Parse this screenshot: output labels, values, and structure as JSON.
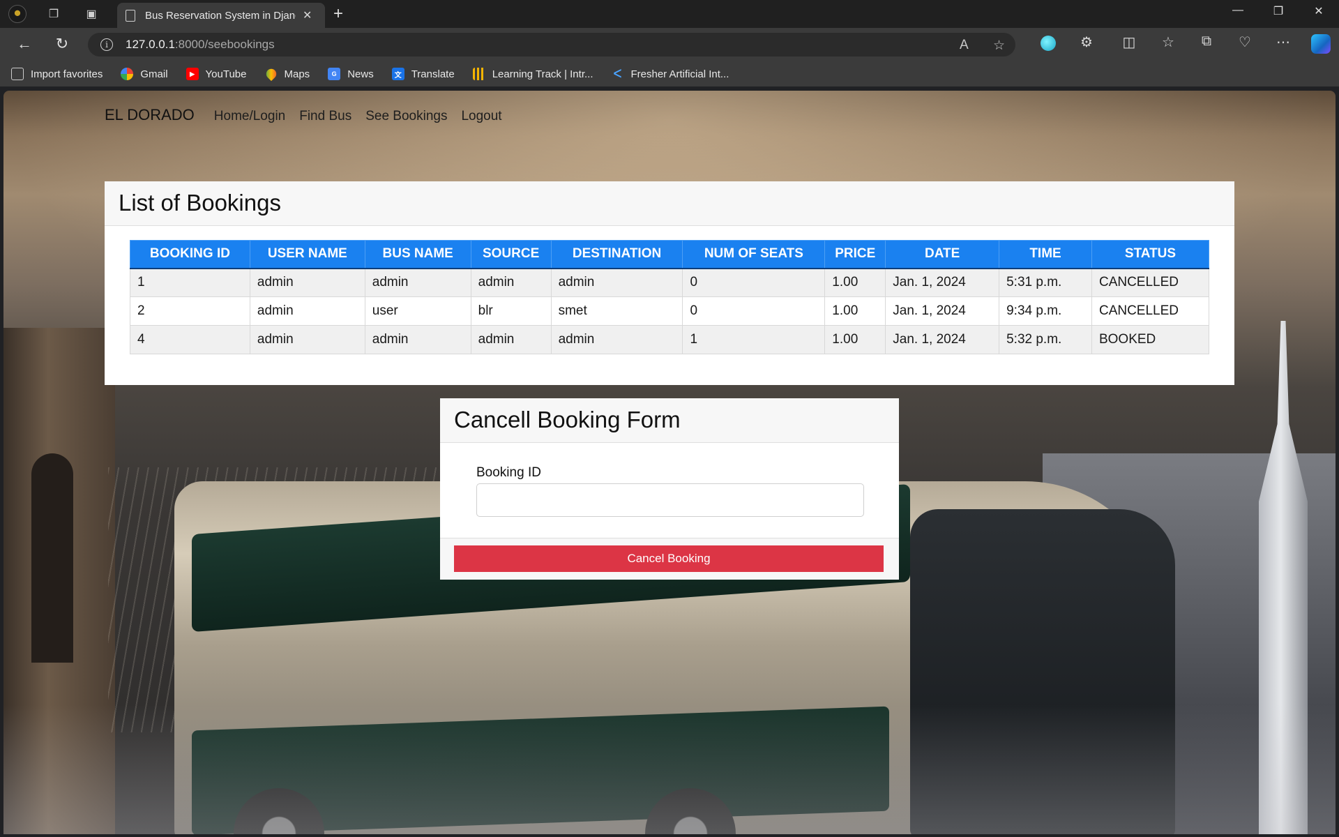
{
  "browser": {
    "tab_title": "Bus Reservation System in Djang",
    "url_host": "127.0.0.1",
    "url_path": ":8000/seebookings",
    "bookmarks": [
      {
        "label": "Import favorites",
        "icon": "import-icon"
      },
      {
        "label": "Gmail",
        "icon": "google-icon"
      },
      {
        "label": "YouTube",
        "icon": "youtube-icon"
      },
      {
        "label": "Maps",
        "icon": "maps-pin-icon"
      },
      {
        "label": "News",
        "icon": "news-icon"
      },
      {
        "label": "Translate",
        "icon": "translate-icon"
      },
      {
        "label": "Learning Track | Intr...",
        "icon": "chart-bars-icon"
      },
      {
        "label": "Fresher Artificial Int...",
        "icon": "k-logo-icon"
      }
    ]
  },
  "site": {
    "brand": "EL DORADO",
    "nav": [
      "Home/Login",
      "Find Bus",
      "See Bookings",
      "Logout"
    ]
  },
  "bookings": {
    "title": "List of Bookings",
    "columns": [
      "BOOKING ID",
      "USER NAME",
      "BUS NAME",
      "SOURCE",
      "DESTINATION",
      "NUM OF SEATS",
      "PRICE",
      "DATE",
      "TIME",
      "STATUS"
    ],
    "rows": [
      [
        "1",
        "admin",
        "admin",
        "admin",
        "admin",
        "0",
        "1.00",
        "Jan. 1, 2024",
        "5:31 p.m.",
        "CANCELLED"
      ],
      [
        "2",
        "admin",
        "user",
        "blr",
        "smet",
        "0",
        "1.00",
        "Jan. 1, 2024",
        "9:34 p.m.",
        "CANCELLED"
      ],
      [
        "4",
        "admin",
        "admin",
        "admin",
        "admin",
        "1",
        "1.00",
        "Jan. 1, 2024",
        "5:32 p.m.",
        "BOOKED"
      ]
    ]
  },
  "cancel_form": {
    "title": "Cancell Booking Form",
    "field_label": "Booking ID",
    "field_value": "",
    "button_label": "Cancel Booking"
  },
  "colors": {
    "table_header": "#1a81f0",
    "cancel_button": "#dc3545"
  }
}
